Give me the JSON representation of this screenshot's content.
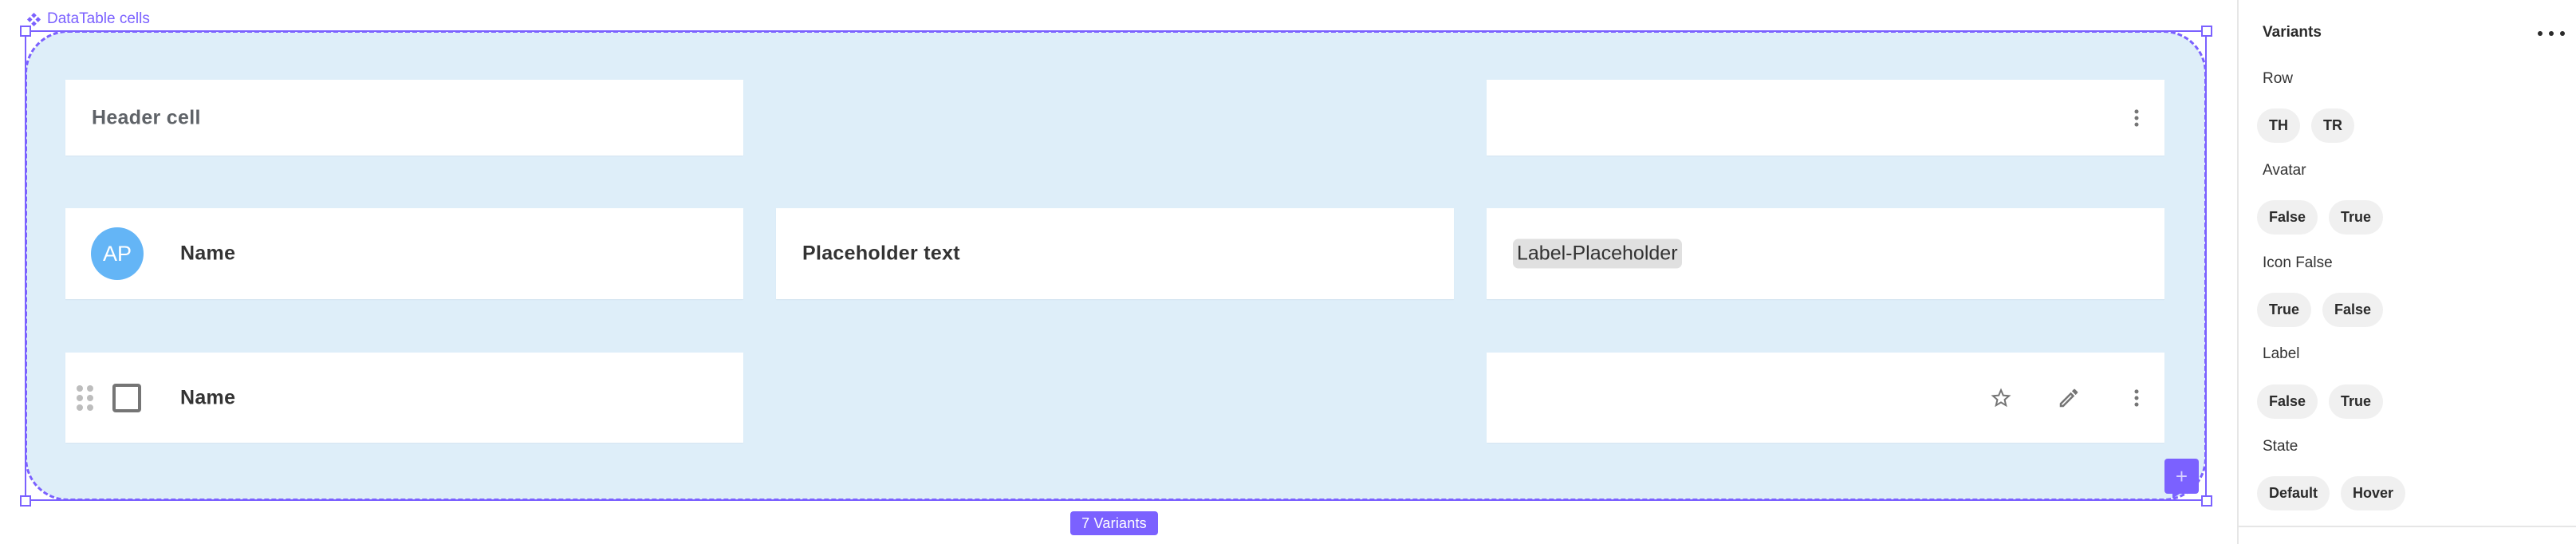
{
  "canvas": {
    "frame_title": "DataTable cells",
    "frame_icon": "component-icon",
    "variants_badge": "7 Variants",
    "add_button_label": "+",
    "accent_color": "#7b61ff",
    "frame_fill_color": "#deeef9"
  },
  "cells": {
    "header_cell": {
      "text": "Header cell"
    },
    "header_menu": {
      "icon": "more-vert-icon"
    },
    "avatar_cell": {
      "initials": "AP",
      "name": "Name",
      "avatar_color": "#64b5f6"
    },
    "text_cell": {
      "text": "Placeholder text"
    },
    "label_cell": {
      "label": "Label-Placeholder"
    },
    "checkbox_cell": {
      "name": "Name",
      "checked": false
    },
    "actions_cell": {
      "icons": [
        "star-outline-icon",
        "pencil-icon",
        "more-vert-icon"
      ]
    }
  },
  "panel": {
    "title": "Variants",
    "more_icon": "more-horizontal-icon",
    "groups": [
      {
        "label": "Row",
        "options": [
          "TH",
          "TR"
        ]
      },
      {
        "label": "Avatar",
        "options": [
          "False",
          "True"
        ]
      },
      {
        "label": "Icon False",
        "options": [
          "True",
          "False"
        ]
      },
      {
        "label": "Label",
        "options": [
          "False",
          "True"
        ]
      },
      {
        "label": "State",
        "options": [
          "Default",
          "Hover"
        ]
      }
    ]
  }
}
